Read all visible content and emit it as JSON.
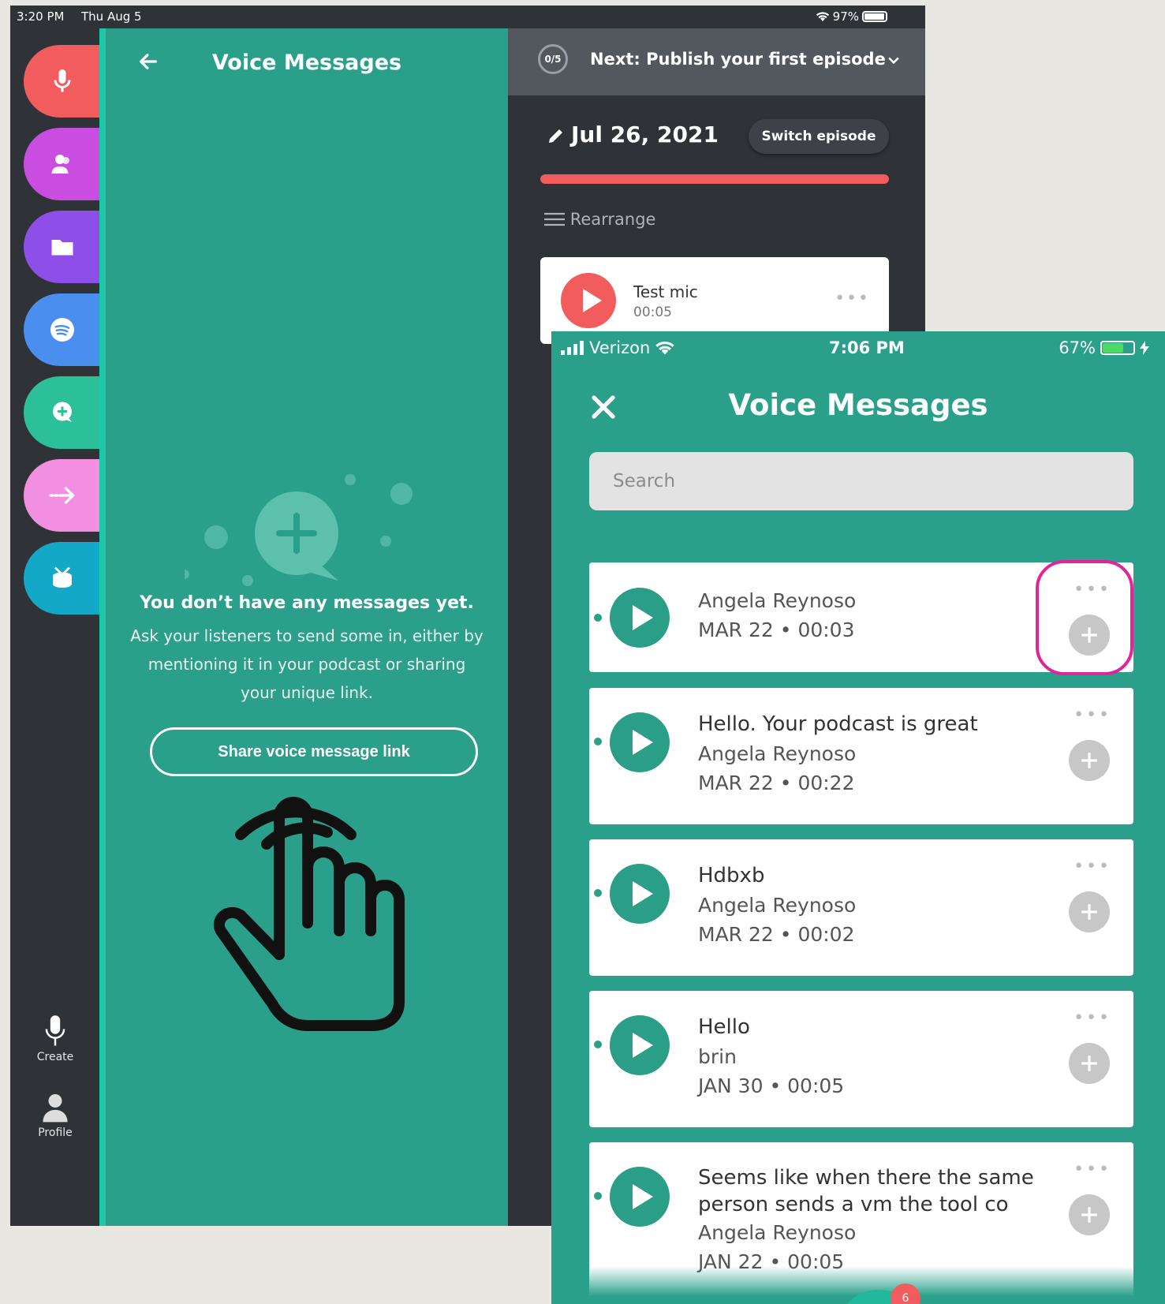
{
  "ipad": {
    "status": {
      "time": "3:20 PM",
      "date": "Thu Aug 5",
      "battery": "97%"
    },
    "rail": {
      "items": [
        {
          "icon": "microphone-icon",
          "color": "#f25c5c"
        },
        {
          "icon": "contacts-icon",
          "color": "#c94de0"
        },
        {
          "icon": "folder-icon",
          "color": "#8e4ee8"
        },
        {
          "icon": "spotify-icon",
          "color": "#4a8fef"
        },
        {
          "icon": "voice-message-icon",
          "color": "#2bbf9a"
        },
        {
          "icon": "transition-arrow-icon",
          "color": "#f28fe0"
        },
        {
          "icon": "drum-icon",
          "color": "#14a8c8"
        }
      ],
      "create_label": "Create",
      "profile_label": "Profile"
    },
    "voice_panel": {
      "title": "Voice Messages",
      "empty_heading": "You don’t have any messages yet.",
      "empty_body": "Ask your listeners to send some in, either by mentioning it in your podcast or sharing your unique link.",
      "share_button": "Share voice message link"
    },
    "episode_panel": {
      "checklist_badge": "0/5",
      "next_label": "Next: Publish your first episode",
      "episode_date": "Jul 26, 2021",
      "switch_button": "Switch episode",
      "progress": 1.0,
      "rearrange_label": "Rearrange",
      "segment": {
        "name": "Test mic",
        "duration": "00:05"
      }
    }
  },
  "phone": {
    "status": {
      "carrier": "Verizon",
      "time": "7:06 PM",
      "battery": "67%"
    },
    "title": "Voice Messages",
    "search_placeholder": "Search",
    "messages": [
      {
        "title": "",
        "author": "Angela Reynoso",
        "meta": "MAR 22 • 00:03"
      },
      {
        "title": "Hello. Your podcast is great",
        "author": "Angela Reynoso",
        "meta": "MAR 22 • 00:22"
      },
      {
        "title": "Hdbxb",
        "author": "Angela Reynoso",
        "meta": "MAR 22 • 00:02"
      },
      {
        "title": "Hello",
        "author": "brin",
        "meta": "JAN 30 • 00:05"
      },
      {
        "title": "Seems like when there the same person sends a vm the tool co",
        "author": "Angela Reynoso",
        "meta": "JAN 22 • 00:05"
      }
    ],
    "bottom_badge": "6"
  }
}
